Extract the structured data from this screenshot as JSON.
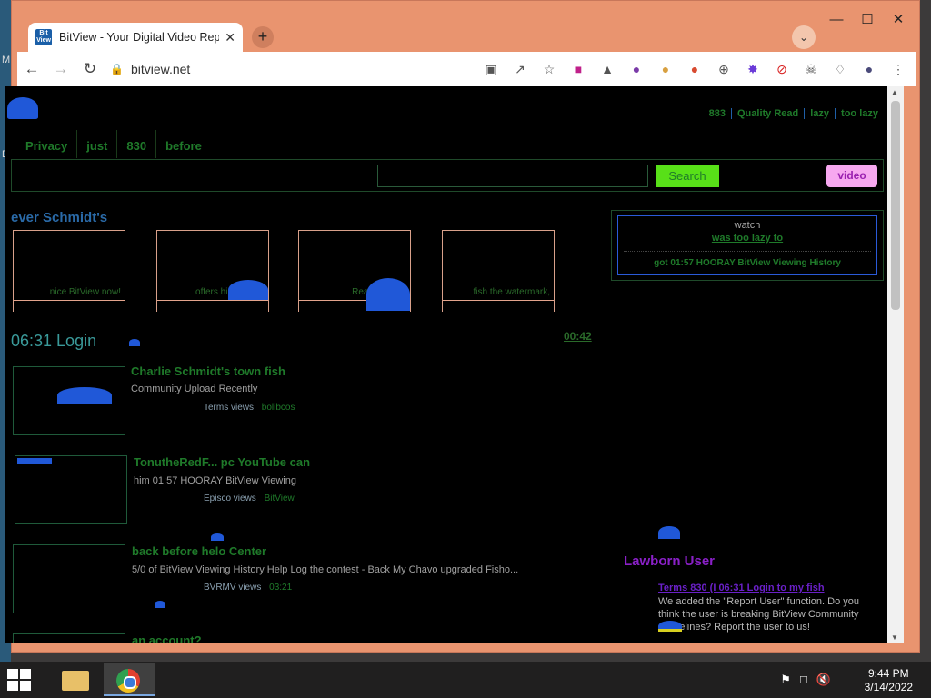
{
  "browser": {
    "tab_title": "BitView - Your Digital Video Repc",
    "favicon_text": "Bit View",
    "url": "bitview.net",
    "window_controls": [
      "minimize",
      "maximize",
      "close"
    ]
  },
  "page": {
    "top_links": [
      "883",
      "Quality Read",
      "lazy",
      "too lazy"
    ],
    "nav_tabs": [
      "Privacy",
      "just",
      "830",
      "before"
    ],
    "search": {
      "placeholder": "",
      "button": "Search",
      "video_button": "video"
    },
    "featured": {
      "title": "ever Schmidt's",
      "items": [
        {
          "caption": "nice BitView now!"
        },
        {
          "caption": "offers him when?"
        },
        {
          "caption": "Read"
        },
        {
          "caption": "fish the watermark,"
        }
      ]
    },
    "section": {
      "title": "06:31 Login",
      "link": "00:42"
    },
    "videos": [
      {
        "title": "Charlie Schmidt's town fish",
        "desc": "Community Upload Recently",
        "views": "Terms views",
        "user": "bolibcos"
      },
      {
        "title": "TonutheRedF... pc YouTube can",
        "desc": "him 01:57 HOORAY BitView Viewing",
        "views": "Episco views",
        "user": "BitView"
      },
      {
        "title": "back before helo Center",
        "desc": "5/0 of BitView Viewing History Help Log the contest - Back My Chavo upgraded Fisho...",
        "views": "BVRMV views",
        "user": "03:21"
      },
      {
        "title": "an account?",
        "desc": "",
        "views": "",
        "user": ""
      }
    ],
    "side_box": {
      "line1": "watch",
      "line2": "was too lazy to",
      "line3": "got 01:57 HOORAY BitView Viewing History"
    },
    "user_panel": {
      "title": "Lawborn User",
      "link": "Terms 830 (I 06:31 Login to my fish",
      "text": "We added the \"Report User\" function. Do you think the user is breaking BitView Community Guidelines? Report the user to us!"
    }
  },
  "taskbar": {
    "time": "9:44 PM",
    "date": "3/14/2022"
  },
  "colors": {
    "accent_green": "#1f7a2a",
    "search_green": "#58e018",
    "video_pink": "#f7a8f0",
    "purple": "#8a20c8",
    "page_bg": "#000000"
  }
}
